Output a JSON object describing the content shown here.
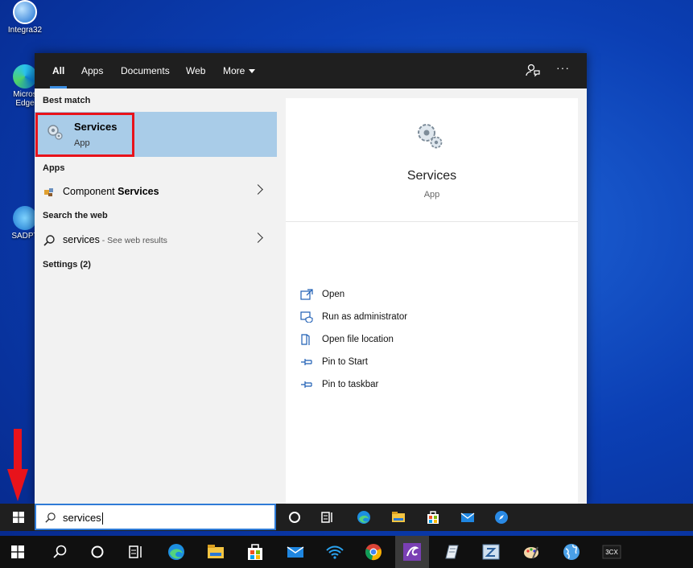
{
  "desktop": {
    "icons": [
      {
        "label": "Integra32"
      },
      {
        "label": "Micros Edge"
      },
      {
        "label": "SADPT"
      }
    ]
  },
  "search_flyout": {
    "tabs": [
      {
        "label": "All",
        "active": true
      },
      {
        "label": "Apps"
      },
      {
        "label": "Documents"
      },
      {
        "label": "Web"
      },
      {
        "label": "More"
      }
    ],
    "sections": {
      "best_match": "Best match",
      "apps": "Apps",
      "search_web": "Search the web",
      "settings": "Settings (2)"
    },
    "best_match": {
      "title": "Services",
      "subtitle": "App"
    },
    "apps_item": {
      "prefix": "Component ",
      "bold": "Services"
    },
    "web_item": {
      "query": "services",
      "suffix": " - See web results"
    },
    "preview": {
      "title": "Services",
      "subtitle": "App",
      "actions": [
        {
          "label": "Open",
          "icon": "open-icon"
        },
        {
          "label": "Run as administrator",
          "icon": "shield-icon"
        },
        {
          "label": "Open file location",
          "icon": "file-location-icon"
        },
        {
          "label": "Pin to Start",
          "icon": "pin-icon"
        },
        {
          "label": "Pin to taskbar",
          "icon": "pin-icon"
        }
      ]
    }
  },
  "search_box": {
    "value": "services"
  },
  "colors": {
    "accent": "#3b8de0",
    "highlight": "#a9cce8",
    "annotation_red": "#e8131b"
  }
}
